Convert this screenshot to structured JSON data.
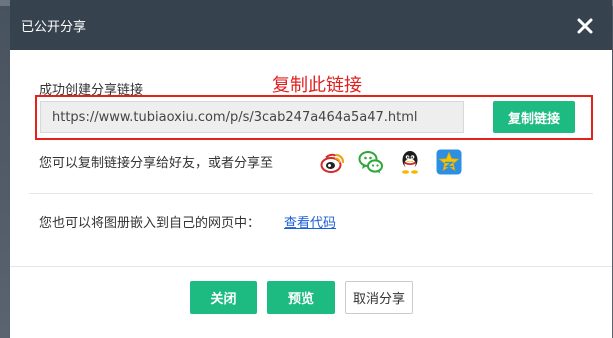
{
  "dialog": {
    "title": "已公开分享",
    "close_icon": "close-icon"
  },
  "annotation": {
    "text": "复制此链接",
    "color": "#e02020"
  },
  "share_link": {
    "label": "成功创建分享链接",
    "url": "https://www.tubiaoxiu.com/p/s/3cab247a464a5a47.html",
    "copy_button": "复制链接"
  },
  "share_to": {
    "label": "您可以复制链接分享给好友，或者分享至",
    "platforms": [
      "weibo-icon",
      "wechat-icon",
      "qq-icon",
      "qzone-icon"
    ]
  },
  "embed": {
    "label": "您也可以将图册嵌入到自己的网页中：",
    "link": "查看代码"
  },
  "footer": {
    "close": "关闭",
    "preview": "预览",
    "cancel_share": "取消分享"
  },
  "colors": {
    "header_bg": "#37424f",
    "accent_green": "#1dbb82",
    "highlight_red": "#e2231a",
    "link_blue": "#1a5fd8"
  }
}
